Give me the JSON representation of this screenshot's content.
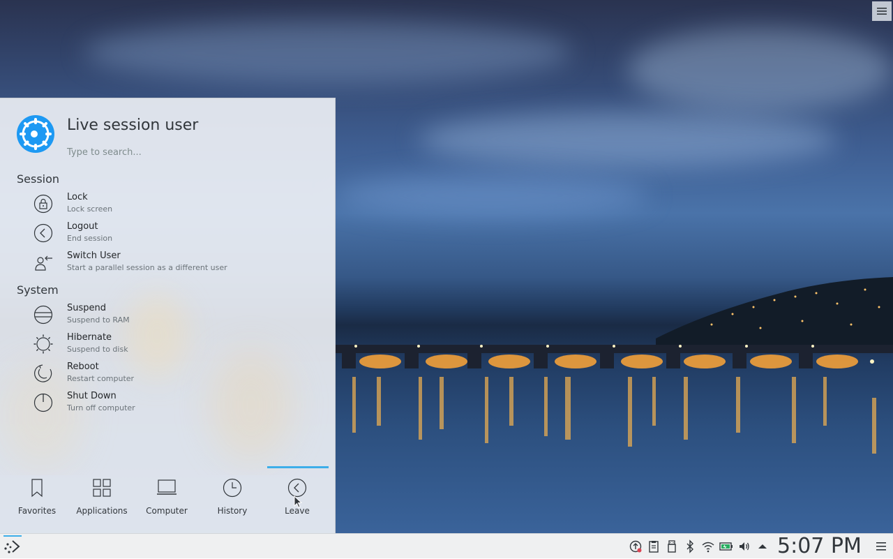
{
  "launcher": {
    "user_name": "Live session user",
    "search_placeholder": "Type to search...",
    "sections": [
      {
        "title": "Session",
        "items": [
          {
            "name": "Lock",
            "desc": "Lock screen",
            "icon": "lock-icon"
          },
          {
            "name": "Logout",
            "desc": "End session",
            "icon": "logout-icon"
          },
          {
            "name": "Switch User",
            "desc": "Start a parallel session as a different user",
            "icon": "switch-user-icon"
          }
        ]
      },
      {
        "title": "System",
        "items": [
          {
            "name": "Suspend",
            "desc": "Suspend to RAM",
            "icon": "suspend-icon"
          },
          {
            "name": "Hibernate",
            "desc": "Suspend to disk",
            "icon": "hibernate-icon"
          },
          {
            "name": "Reboot",
            "desc": "Restart computer",
            "icon": "reboot-icon"
          },
          {
            "name": "Shut Down",
            "desc": "Turn off computer",
            "icon": "shutdown-icon"
          }
        ]
      }
    ],
    "tabs": [
      {
        "label": "Favorites",
        "icon": "bookmark-icon"
      },
      {
        "label": "Applications",
        "icon": "grid-icon"
      },
      {
        "label": "Computer",
        "icon": "laptop-icon"
      },
      {
        "label": "History",
        "icon": "clock-icon"
      },
      {
        "label": "Leave",
        "icon": "leave-icon",
        "active": true
      }
    ]
  },
  "taskbar": {
    "clock": "5:07 PM",
    "tray_icons": [
      "updates-icon",
      "clipboard-icon",
      "usb-device-icon",
      "bluetooth-icon",
      "wifi-icon",
      "battery-icon",
      "volume-icon",
      "expand-tray-icon"
    ]
  },
  "colors": {
    "accent": "#3daee9",
    "kde_blue": "#1d99f3",
    "panel_bg": "#eff0f1"
  }
}
